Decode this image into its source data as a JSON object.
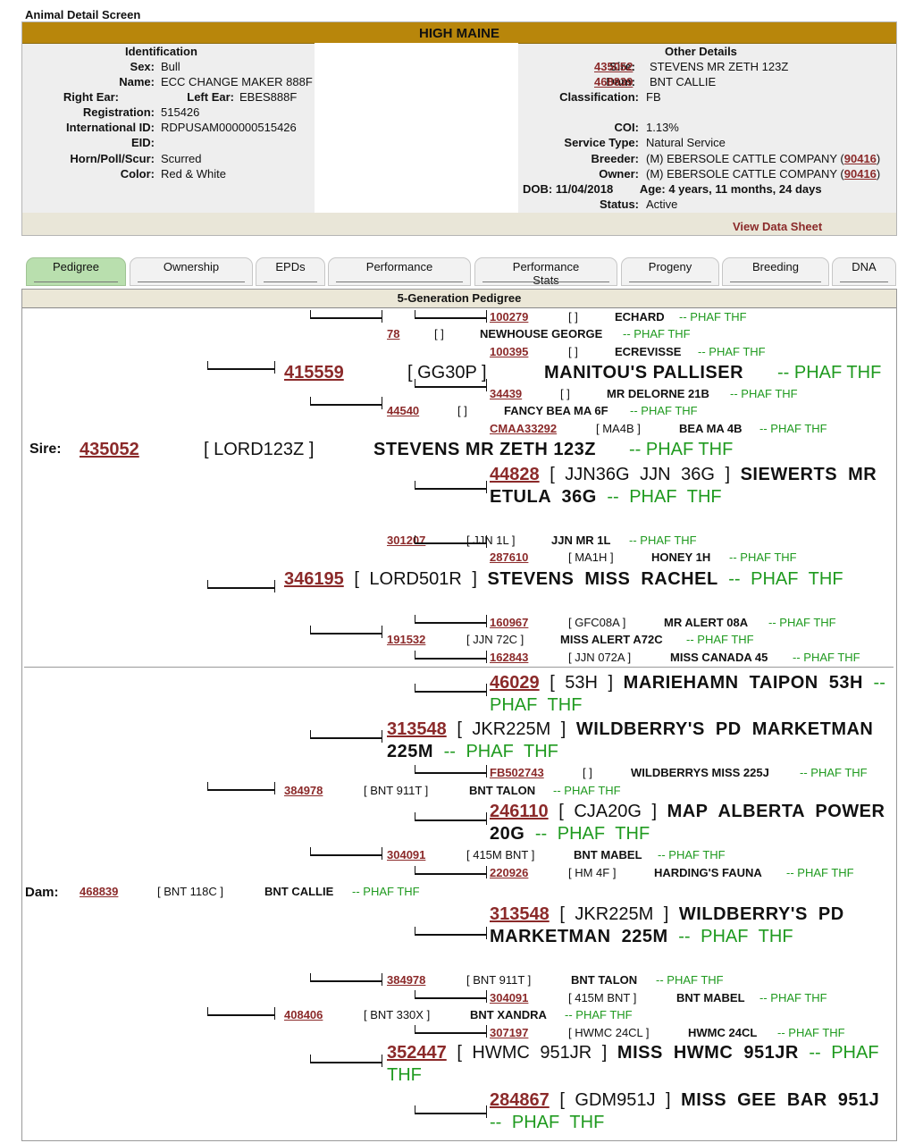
{
  "screen_title": "Animal Detail Screen",
  "header": {
    "ranch": "HIGH MAINE"
  },
  "identification": {
    "heading": "Identification",
    "fields": [
      {
        "label": "Sex:",
        "value": "Bull"
      },
      {
        "label": "Name:",
        "value": "ECC CHANGE MAKER 888F"
      },
      {
        "label": "Right Ear:",
        "value": ""
      },
      {
        "label": "Left Ear:",
        "value": "EBES888F"
      },
      {
        "label": "Registration:",
        "value": "515426"
      },
      {
        "label": "International ID:",
        "value": "RDPUSAM000000515426"
      },
      {
        "label": "EID:",
        "value": ""
      },
      {
        "label": "Horn/Poll/Scur:",
        "value": "Scurred"
      },
      {
        "label": "Color:",
        "value": "Red & White"
      }
    ]
  },
  "other": {
    "heading": "Other Details",
    "sire_label": "Sire:",
    "sire_id": "435052",
    "sire_name": "STEVENS MR ZETH 123Z",
    "dam_label": "Dam:",
    "dam_id": "468839",
    "dam_name": "BNT CALLIE",
    "class_label": "Classification:",
    "class_value": "FB",
    "coi_label": "COI:",
    "coi_value": "1.13%",
    "service_label": "Service Type:",
    "service_value": "Natural Service",
    "breeder_label": "Breeder:",
    "breeder_value": "(M) EBERSOLE CATTLE COMPANY (",
    "breeder_id": "90416",
    "breeder_close": ")",
    "owner_label": "Owner:",
    "owner_value": "(M) EBERSOLE CATTLE COMPANY (",
    "owner_id": "90416",
    "owner_close": ")",
    "dob_label": "DOB:",
    "dob_value": "11/04/2018",
    "age_label": "Age:",
    "age_value": "4 years, 11 months, 24 days",
    "status_label": "Status:",
    "status_value": "Active"
  },
  "view_data_sheet": "View Data Sheet",
  "tabs": [
    {
      "label": "Pedigree"
    },
    {
      "label": "Ownership"
    },
    {
      "label": "EPDs"
    },
    {
      "label": "Performance"
    },
    {
      "label": "Performance Stats"
    },
    {
      "label": "Progeny"
    },
    {
      "label": "Breeding"
    },
    {
      "label": "DNA"
    }
  ],
  "pedigree_title": "5-Generation Pedigree",
  "pedigree": {
    "sire_label": "Sire:",
    "dam_label": "Dam:",
    "entries": [
      {
        "id": "100279",
        "reg": "[ ]",
        "name": "ECHARD",
        "breed": "-- PHAF THF"
      },
      {
        "id": "78",
        "reg": "[ ]",
        "name": "NEWHOUSE GEORGE",
        "breed": "-- PHAF THF"
      },
      {
        "id": "100395",
        "reg": "[ ]",
        "name": "ECREVISSE",
        "breed": "-- PHAF THF"
      },
      {
        "id": "415559",
        "reg": "[ GG30P ]",
        "name": "MANITOU'S PALLISER",
        "breed": "-- PHAF THF"
      },
      {
        "id": "34439",
        "reg": "[ ]",
        "name": "MR DELORNE 21B",
        "breed": "-- PHAF THF"
      },
      {
        "id": "44540",
        "reg": "[ ]",
        "name": "FANCY BEA MA 6F",
        "breed": "-- PHAF THF"
      },
      {
        "id": "CMAA33292",
        "reg": "[ MA4B ]",
        "name": "BEA MA 4B",
        "breed": "-- PHAF THF"
      },
      {
        "id": "435052",
        "reg": "[ LORD123Z ]",
        "name": "STEVENS MR ZETH 123Z",
        "breed": "-- PHAF THF"
      },
      {
        "id": "44828",
        "reg": "[ JJN36G JJN 36G ]",
        "name": "SIEWERTS MR ETULA 36G",
        "breed": "-- PHAF THF"
      },
      {
        "id": "301207",
        "reg": "[ JJN 1L ]",
        "name": "JJN MR 1L",
        "breed": "-- PHAF THF"
      },
      {
        "id": "287610",
        "reg": "[ MA1H ]",
        "name": "HONEY 1H",
        "breed": "-- PHAF THF"
      },
      {
        "id": "346195",
        "reg": "[ LORD501R ]",
        "name": "STEVENS MISS RACHEL",
        "breed": "-- PHAF THF"
      },
      {
        "id": "160967",
        "reg": "[ GFC08A ]",
        "name": "MR ALERT 08A",
        "breed": "-- PHAF THF"
      },
      {
        "id": "191532",
        "reg": "[ JJN 72C ]",
        "name": "MISS ALERT A72C",
        "breed": "-- PHAF THF"
      },
      {
        "id": "162843",
        "reg": "[ JJN 072A ]",
        "name": "MISS CANADA 45",
        "breed": "-- PHAF THF"
      },
      {
        "id": "46029",
        "reg": "[ 53H ]",
        "name": "MARIEHAMN TAIPON 53H",
        "breed": "-- PHAF THF"
      },
      {
        "id": "313548",
        "reg": "[ JKR225M ]",
        "name": "WILDBERRY'S PD MARKETMAN 225M",
        "breed": "-- PHAF THF"
      },
      {
        "id": "FB502743",
        "reg": "[ ]",
        "name": "WILDBERRYS MISS 225J",
        "breed": "-- PHAF THF"
      },
      {
        "id": "384978",
        "reg": "[ BNT 911T ]",
        "name": "BNT TALON",
        "breed": "-- PHAF THF"
      },
      {
        "id": "246110",
        "reg": "[ CJA20G ]",
        "name": "MAP ALBERTA POWER 20G",
        "breed": "-- PHAF THF"
      },
      {
        "id": "304091",
        "reg": "[ 415M BNT ]",
        "name": "BNT MABEL",
        "breed": "-- PHAF THF"
      },
      {
        "id": "220926",
        "reg": "[ HM 4F ]",
        "name": "HARDING'S FAUNA",
        "breed": "-- PHAF THF"
      },
      {
        "id": "468839",
        "reg": "[ BNT 118C ]",
        "name": "BNT CALLIE",
        "breed": "-- PHAF THF"
      },
      {
        "id": "313548",
        "reg": "[ JKR225M ]",
        "name": "WILDBERRY'S PD MARKETMAN 225M",
        "breed": "-- PHAF THF"
      },
      {
        "id": "384978",
        "reg": "[ BNT 911T ]",
        "name": "BNT TALON",
        "breed": "-- PHAF THF"
      },
      {
        "id": "304091",
        "reg": "[ 415M BNT ]",
        "name": "BNT MABEL",
        "breed": "-- PHAF THF"
      },
      {
        "id": "408406",
        "reg": "[ BNT 330X ]",
        "name": "BNT XANDRA",
        "breed": "-- PHAF THF"
      },
      {
        "id": "307197",
        "reg": "[ HWMC 24CL ]",
        "name": "HWMC 24CL",
        "breed": "-- PHAF THF"
      },
      {
        "id": "352447",
        "reg": "[ HWMC 951JR ]",
        "name": "MISS HWMC 951JR",
        "breed": "-- PHAF THF"
      },
      {
        "id": "284867",
        "reg": "[ GDM951J ]",
        "name": "MISS GEE BAR 951J",
        "breed": "-- PHAF THF"
      }
    ]
  }
}
